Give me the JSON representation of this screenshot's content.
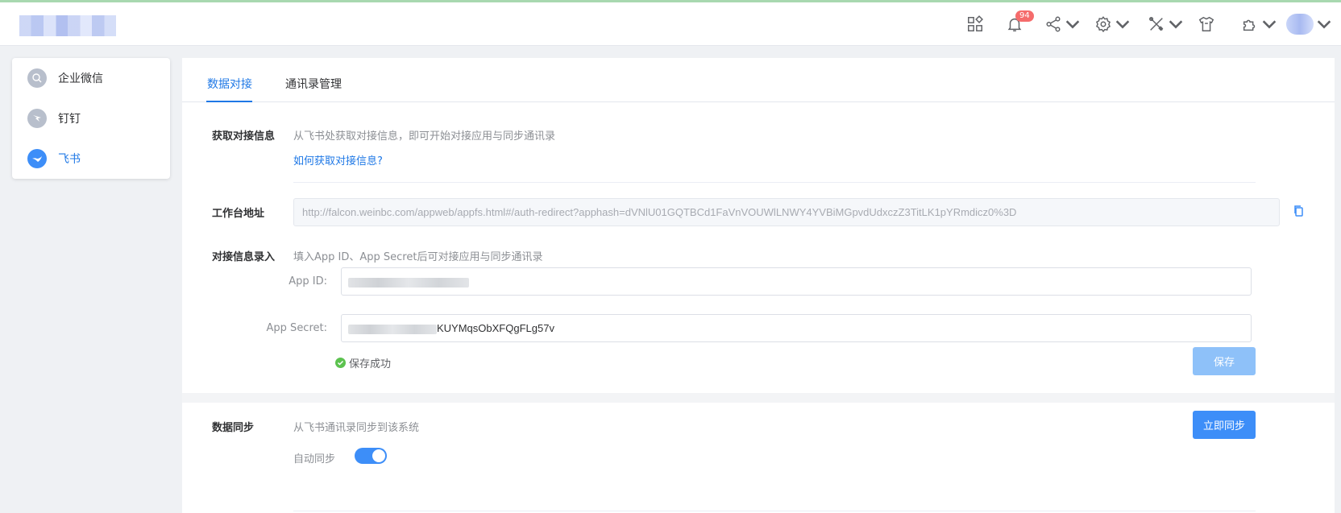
{
  "header": {
    "notification_count": "94"
  },
  "sidebar": {
    "items": [
      {
        "label": "企业微信",
        "icon": "wecom-icon",
        "active": false
      },
      {
        "label": "钉钉",
        "icon": "dingtalk-icon",
        "active": false
      },
      {
        "label": "飞书",
        "icon": "feishu-icon",
        "active": true
      }
    ]
  },
  "tabs": [
    {
      "label": "数据对接",
      "active": true
    },
    {
      "label": "通讯录管理",
      "active": false
    }
  ],
  "section_connect": {
    "label": "获取对接信息",
    "hint": "从飞书处获取对接信息，即可开始对接应用与同步通讯录",
    "help_link": "如何获取对接信息?"
  },
  "workbench": {
    "label": "工作台地址",
    "url": "http://falcon.weinbc.com/appweb/appfs.html#/auth-redirect?apphash=dVNlU01GQTBCd1FaVnVOUWlLNWY4YVBiMGpvdUdxczZ3TitLK1pYRmdicz0%3D"
  },
  "entry": {
    "label": "对接信息录入",
    "hint": "填入App ID、App Secret后可对接应用与同步通讯录",
    "app_id_label": "App ID:",
    "app_secret_label": "App Secret:",
    "app_secret_visible": "KUYMqsObXFQgFLg57v",
    "success_text": "保存成功",
    "save_button": "保存"
  },
  "sync": {
    "label": "数据同步",
    "hint": "从飞书通讯录同步到该系统",
    "sync_button": "立即同步",
    "auto_label": "自动同步",
    "auto_enabled": true
  },
  "colors": {
    "primary": "#3d8ef8",
    "primary_light": "#8ec1f9",
    "success": "#5cc24f",
    "badge": "#f56c6c"
  }
}
